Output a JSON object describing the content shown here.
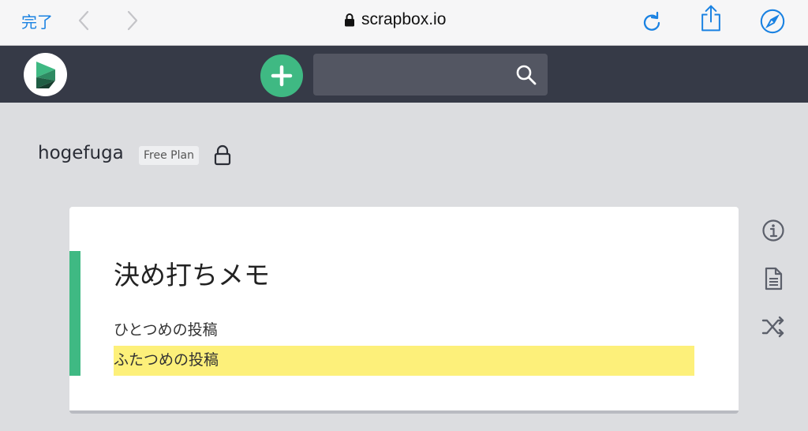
{
  "browser": {
    "done_label": "完了",
    "address": "scrapbox.io",
    "accent_color": "#1a82e2"
  },
  "header": {
    "background": "#363a47",
    "new_button_color": "#3fb983",
    "search": {
      "value": "",
      "placeholder": ""
    }
  },
  "project": {
    "name": "hogefuga",
    "plan": "Free Plan"
  },
  "card": {
    "title": "決め打ちメモ",
    "lines": [
      "ひとつめの投稿",
      "ふたつめの投稿"
    ],
    "highlight_color": "#fdf07a",
    "accent_color": "#3fb983"
  },
  "side_icons": [
    "info-icon",
    "document-icon",
    "shuffle-icon"
  ]
}
